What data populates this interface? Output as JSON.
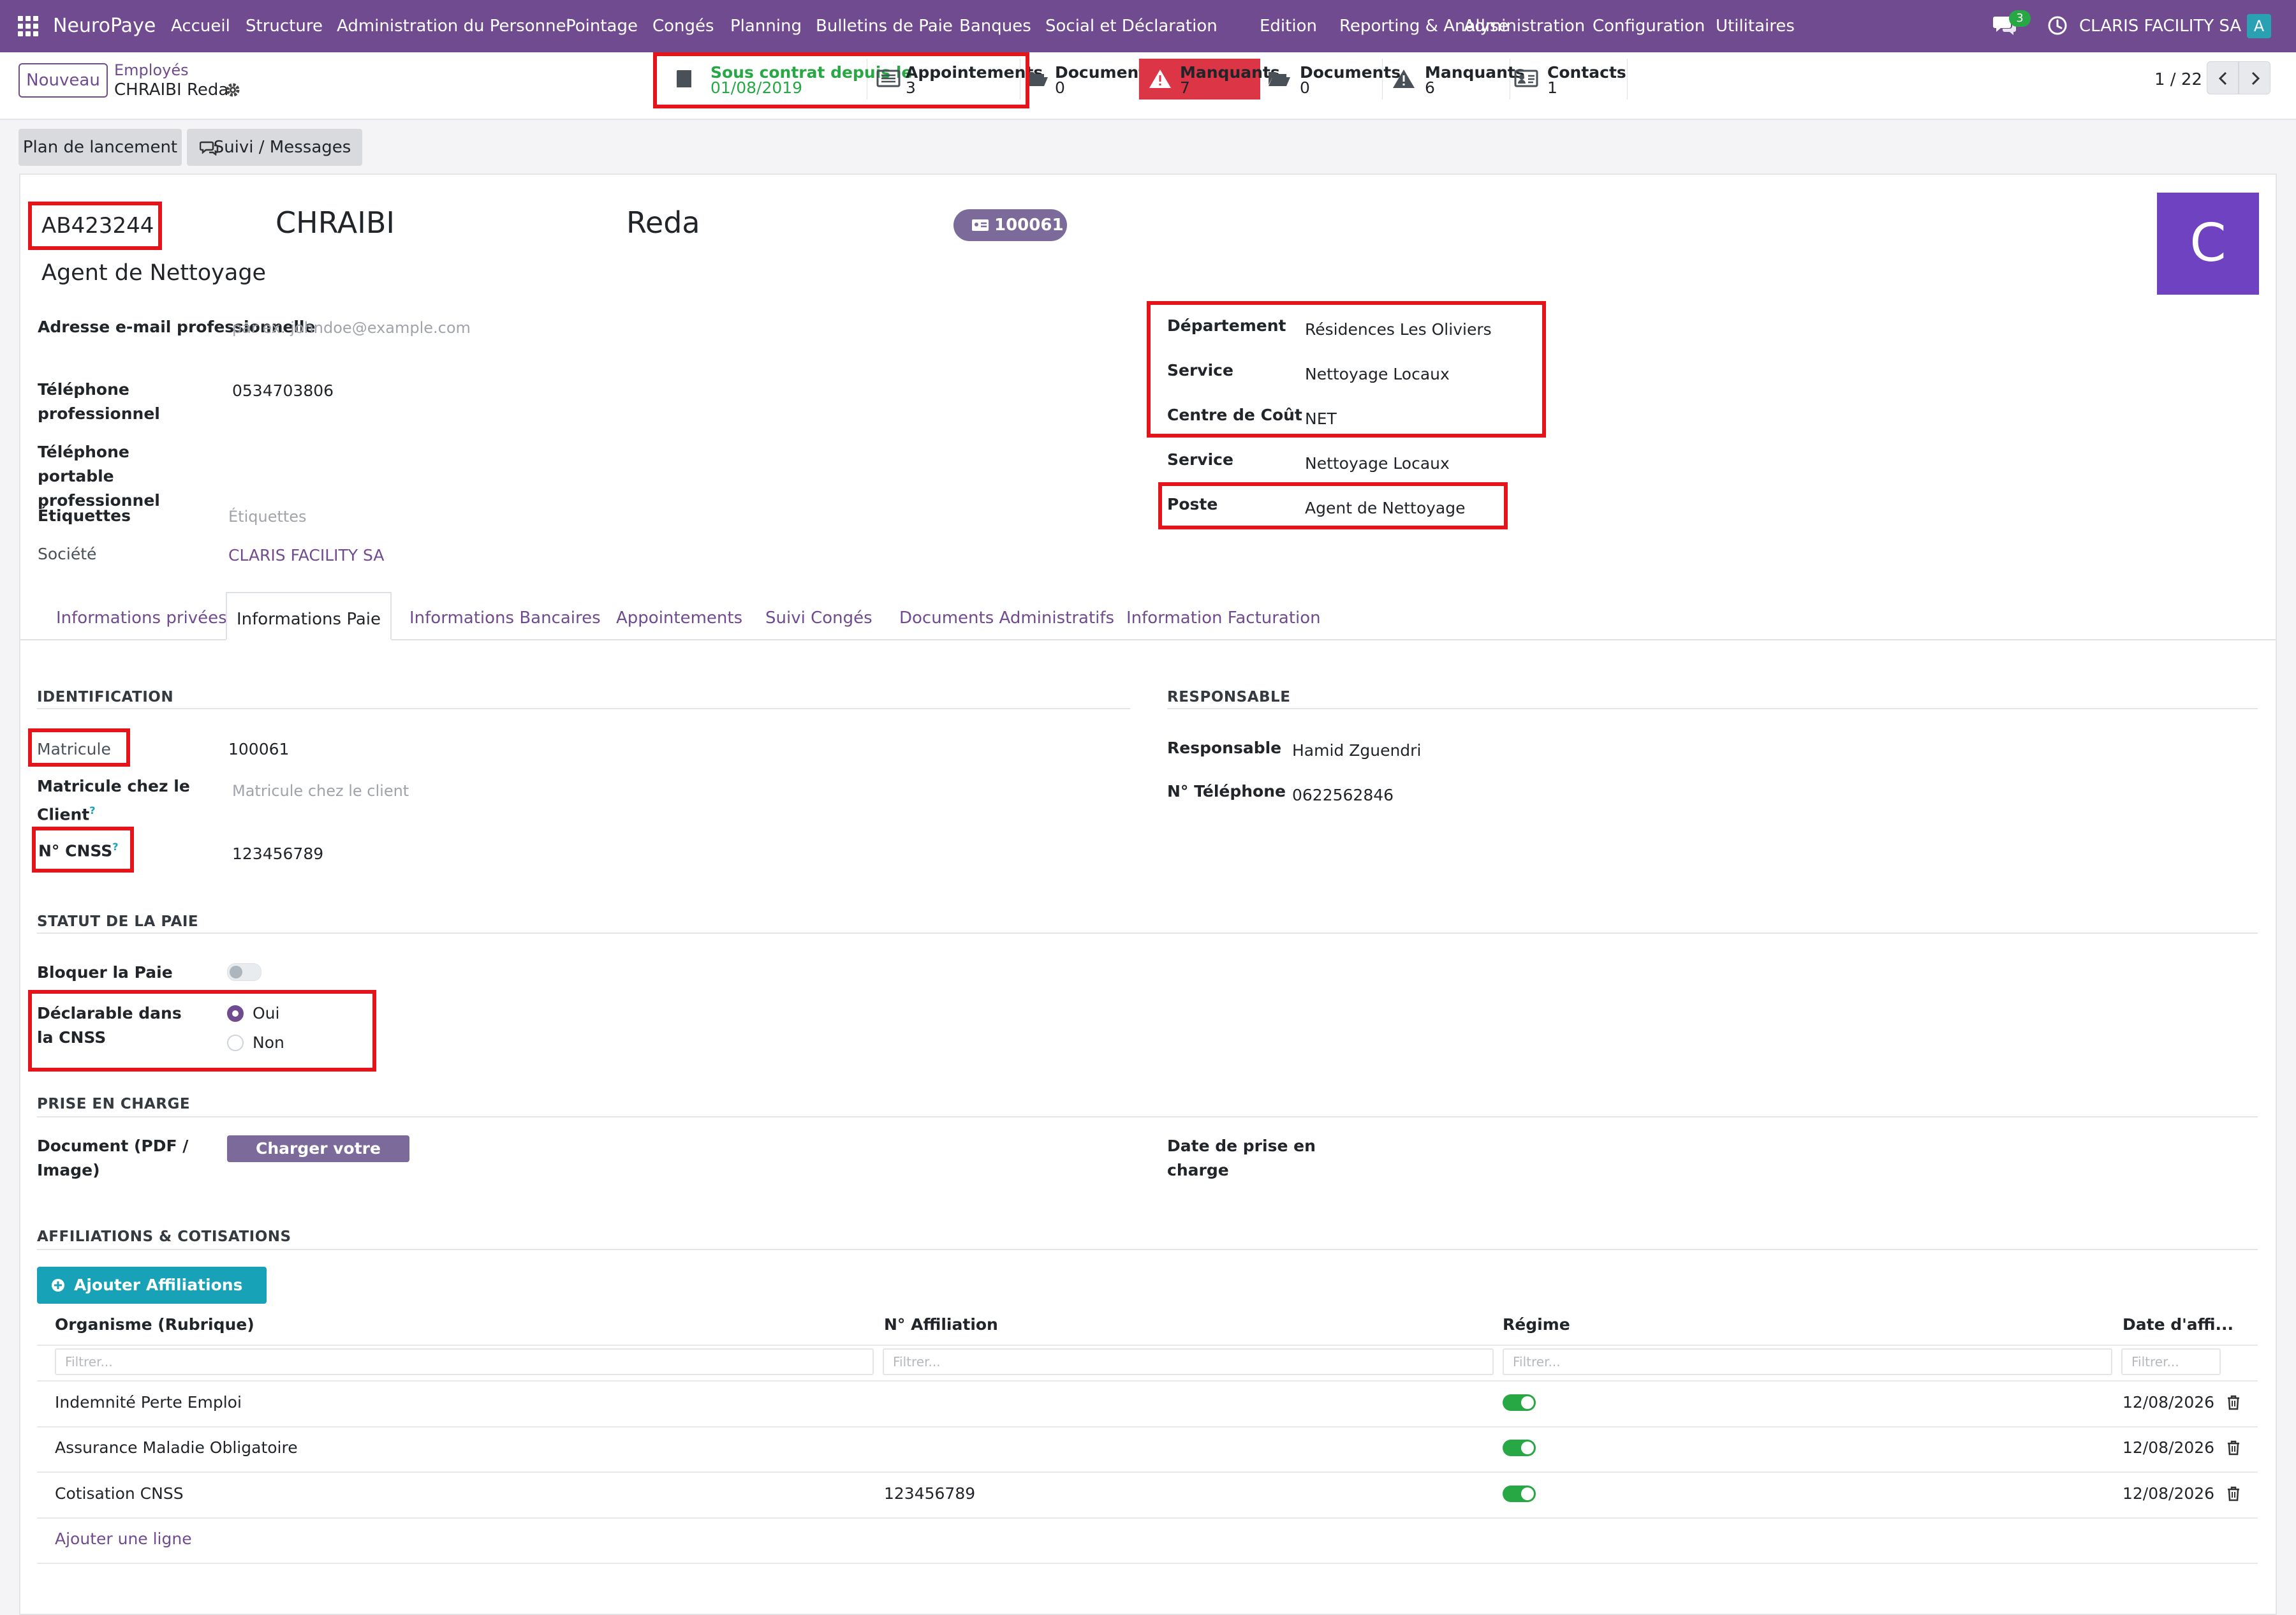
{
  "navbar": {
    "brand": "NeuroPaye",
    "menu": [
      "Accueil",
      "Structure",
      "Administration du Personnel",
      "Pointage",
      "Congés",
      "Planning",
      "Bulletins de Paie",
      "Banques",
      "Social et Déclaration",
      "Edition",
      "Reporting & Analyse",
      "Administration",
      "Configuration",
      "Utilitaires"
    ],
    "chat_count": "3",
    "company": "CLARIS FACILITY SA",
    "user_initial": "A"
  },
  "control": {
    "new_label": "Nouveau",
    "breadcrumb_parent": "Employés",
    "breadcrumb_current": "CHRAIBI Reda",
    "pager": "1 / 22"
  },
  "smart_buttons": [
    {
      "label": "Sous contrat depuis le",
      "value": "01/08/2019"
    },
    {
      "label": "Appointements",
      "value": "3"
    },
    {
      "label": "Documents",
      "value": "0"
    },
    {
      "label": "Manquants",
      "value": "7"
    },
    {
      "label": "Documents",
      "value": "0"
    },
    {
      "label": "Manquants",
      "value": "6"
    },
    {
      "label": "Contacts",
      "value": "1"
    }
  ],
  "status_buttons": {
    "plan": "Plan de lancement",
    "suivi": "Suivi / Messages"
  },
  "employee": {
    "code": "AB423244",
    "last_name": "CHRAIBI",
    "first_name": "Reda",
    "badge": "100061",
    "job_title": "Agent de Nettoyage",
    "avatar_letter": "C",
    "avatar_color": "#6f42c1"
  },
  "left_fields": [
    {
      "label": "Adresse e-mail professionnelle",
      "value": "",
      "placeholder": "par ex. johndoe@example.com"
    },
    {
      "label": "Téléphone professionnel",
      "value": "0534703806"
    },
    {
      "label": "Téléphone portable professionnel",
      "value": ""
    },
    {
      "label": "Étiquettes",
      "value": "",
      "placeholder": "Étiquettes"
    },
    {
      "label": "Société",
      "value": "CLARIS FACILITY SA"
    }
  ],
  "right_fields": [
    {
      "label": "Département",
      "value": "Résidences Les Oliviers"
    },
    {
      "label": "Service",
      "value": "Nettoyage Locaux"
    },
    {
      "label": "Centre de Coût",
      "value": "NET"
    },
    {
      "label": "Service",
      "value": "Nettoyage Locaux"
    },
    {
      "label": "Poste",
      "value": "Agent de Nettoyage"
    }
  ],
  "tabs": [
    "Informations privées",
    "Informations Paie",
    "Informations Bancaires",
    "Appointements",
    "Suivi Congés",
    "Documents Administratifs",
    "Information Facturation"
  ],
  "identification": {
    "title": "IDENTIFICATION",
    "matricule_label": "Matricule",
    "matricule_value": "100061",
    "client_label": "Matricule chez le Client",
    "client_placeholder": "Matricule chez le client",
    "cnss_label": "N° CNSS",
    "cnss_value": "123456789",
    "help_mark": "?"
  },
  "responsable": {
    "title": "RESPONSABLE",
    "name_label": "Responsable",
    "name_value": "Hamid Zguendri",
    "phone_label": "N° Téléphone",
    "phone_value": "0622562846"
  },
  "statut": {
    "title": "STATUT DE LA PAIE",
    "bloquer_label": "Bloquer la Paie",
    "declarable_label": "Déclarable dans la CNSS",
    "option_yes": "Oui",
    "option_no": "Non"
  },
  "prise": {
    "title": "PRISE EN CHARGE",
    "doc_label": "Document (PDF / Image)",
    "upload_label": "Charger votre fichier",
    "date_label": "Date de prise en charge"
  },
  "affiliations": {
    "title": "AFFILIATIONS & COTISATIONS",
    "add_auto_label": "Ajouter Affiliations Auto",
    "columns": [
      "Organisme (Rubrique)",
      "N° Affiliation",
      "Régime",
      "Date d'affi..."
    ],
    "filter_placeholder": "Filtrer...",
    "rows": [
      {
        "organisme": "Indemnité Perte Emploi",
        "affiliation": "",
        "date": "12/08/2026"
      },
      {
        "organisme": "Assurance Maladie Obligatoire",
        "affiliation": "",
        "date": "12/08/2026"
      },
      {
        "organisme": "Cotisation CNSS",
        "affiliation": "123456789",
        "date": "12/08/2026"
      }
    ],
    "add_line_label": "Ajouter une ligne"
  },
  "colors": {
    "brand": "#714b8f",
    "danger": "#dc3545",
    "success": "#28a745",
    "teal": "#17a2b8",
    "highlight": "#e4141b"
  }
}
